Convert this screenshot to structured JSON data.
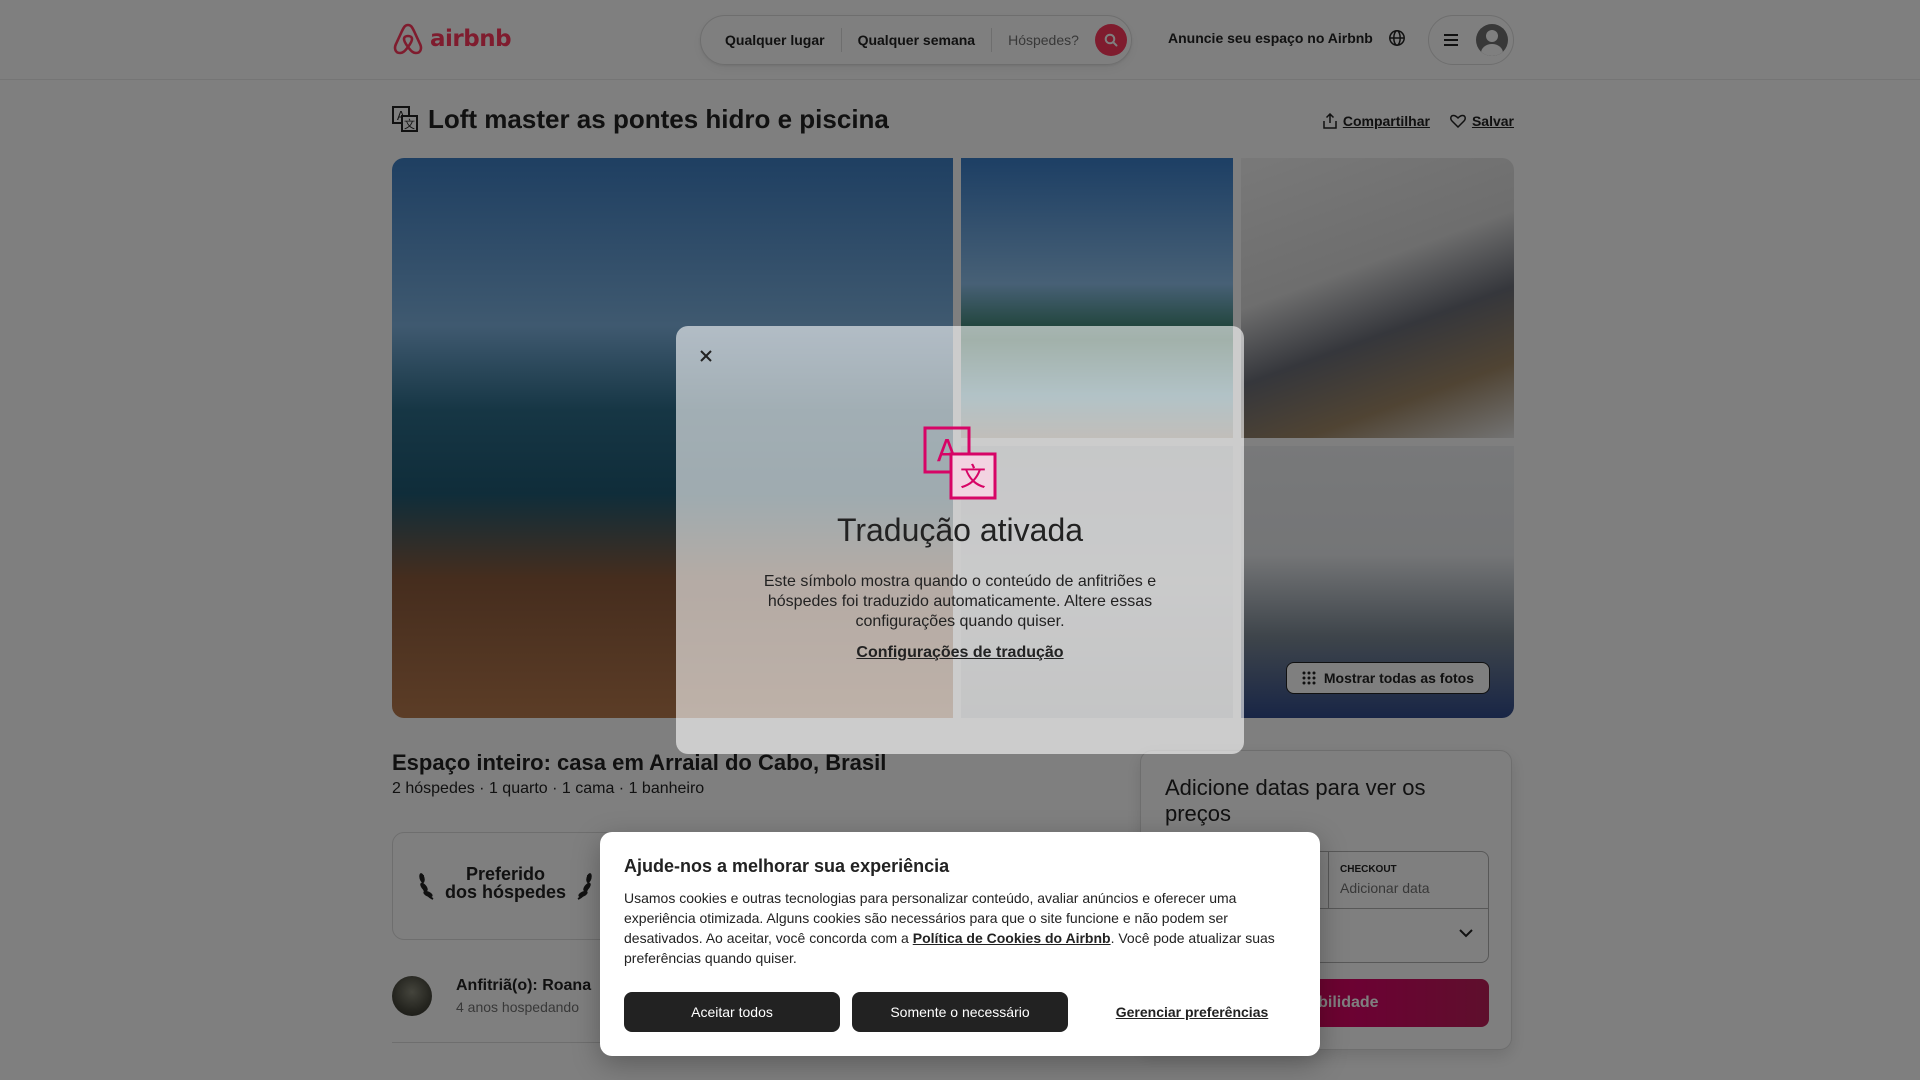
{
  "header": {
    "logo_text": "airbnb",
    "search": {
      "location": "Qualquer lugar",
      "week": "Qualquer semana",
      "guests": "Hóspedes?"
    },
    "host_link": "Anuncie seu espaço no Airbnb",
    "brand_color": "#ff385c"
  },
  "listing": {
    "title": "Loft master as pontes hidro e piscina",
    "share_label": "Compartilhar",
    "save_label": "Salvar",
    "show_all_photos": "Mostrar todas as fotos",
    "subtitle": "Espaço inteiro: casa em Arraial do Cabo, Brasil",
    "specs": "2 hóspedes · 1 quarto · 1 cama · 1 banheiro",
    "badge": {
      "line1": "Preferido",
      "line2": "dos hóspedes"
    },
    "host": {
      "name": "Anfitriã(o): Roana",
      "years": "4 anos hospedando"
    }
  },
  "booking": {
    "title": "Adicione datas para ver os preços",
    "checkout_label": "CHECKOUT",
    "checkout_value": "Adicionar data",
    "availability_button": "sponibilidade"
  },
  "translation_modal": {
    "title": "Tradução ativada",
    "text": "Este símbolo mostra quando o conteúdo de anfitriões e hóspedes foi traduzido automaticamente. Altere essas configurações quando quiser.",
    "link": "Configurações de tradução",
    "accent_color": "#d70466"
  },
  "cookie_banner": {
    "title": "Ajude-nos a melhorar sua experiência",
    "text_before": "Usamos cookies e outras tecnologias para personalizar conteúdo, avaliar anúncios e oferecer uma experiência otimizada. Alguns cookies são necessários para que o site funcione e não podem ser desativados. Ao aceitar, você concorda com a ",
    "policy_link": "Política de Cookies do Airbnb",
    "text_after": ". Você pode atualizar suas preferências quando quiser.",
    "accept_all": "Aceitar todos",
    "only_necessary": "Somente o necessário",
    "manage": "Gerenciar preferências"
  }
}
